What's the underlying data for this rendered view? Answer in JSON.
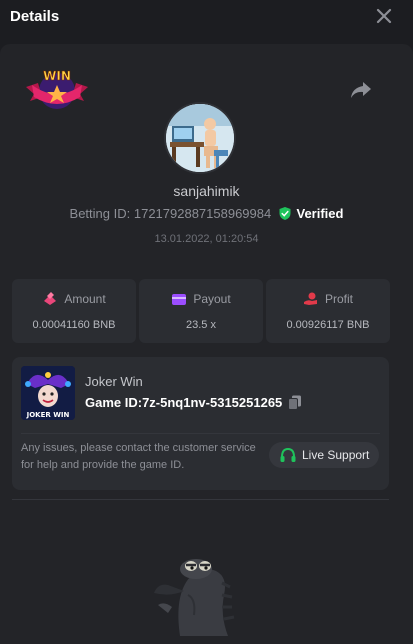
{
  "header": {
    "title": "Details"
  },
  "bet": {
    "username": "sanjahimik",
    "betting_id_label": "Betting ID:",
    "betting_id": "1721792887158969984",
    "verified_label": "Verified",
    "date": "13.01.2022, 01:20:54"
  },
  "badge": {
    "text": "WIN"
  },
  "stats": {
    "amount": {
      "label": "Amount",
      "value": "0.00041160 BNB"
    },
    "payout": {
      "label": "Payout",
      "value": "23.5 x"
    },
    "profit": {
      "label": "Profit",
      "value": "0.00926117 BNB"
    }
  },
  "game": {
    "name": "Joker Win",
    "id_label": "Game ID:",
    "id": "7z-5nq1nv-5315251265",
    "thumb_text": "JOKER WIN",
    "help_text": "Any issues, please contact the customer service for help and provide the game ID.",
    "support_label": "Live Support"
  },
  "colors": {
    "background": "#1c1d21",
    "panel": "#232428",
    "card": "#2b2d32",
    "verified_green": "#1fc35c",
    "amount_icon": "#e9467a",
    "payout_icon": "#9b4dff",
    "profit_icon": "#e23a4a",
    "support_icon": "#1fc35c"
  },
  "icons": {
    "close": "close-icon",
    "share": "share-icon",
    "verified": "shield-check-icon",
    "amount": "chip-icon",
    "payout": "wallet-icon",
    "profit": "coin-hand-icon",
    "copy": "copy-icon",
    "support": "headset-icon"
  }
}
